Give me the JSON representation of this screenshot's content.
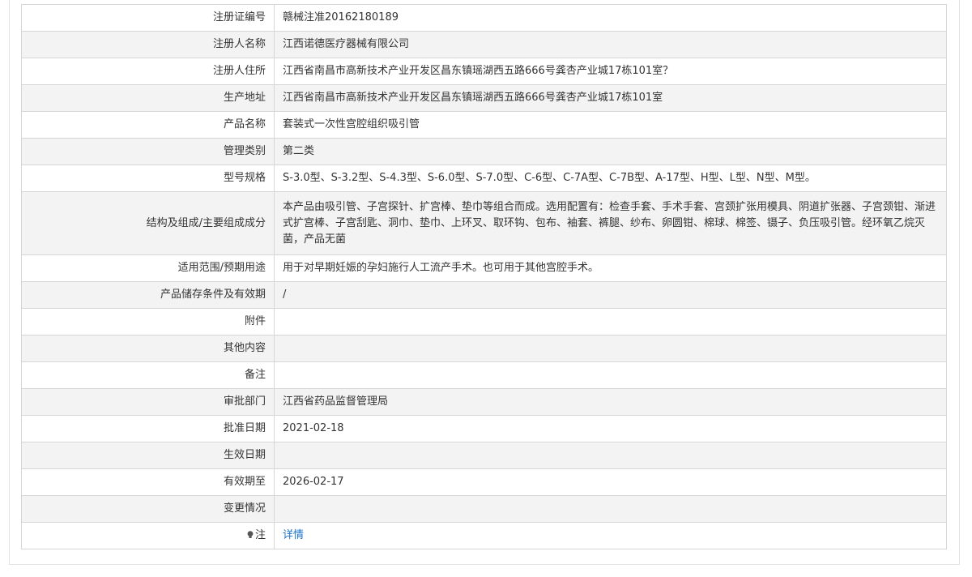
{
  "rows": [
    {
      "label": "注册证编号",
      "value": "赣械注准20162180189"
    },
    {
      "label": "注册人名称",
      "value": "江西诺德医疗器械有限公司"
    },
    {
      "label": "注册人住所",
      "value": "江西省南昌市高新技术产业开发区昌东镇瑶湖西五路666号龚杏产业城17栋101室？"
    },
    {
      "label": "生产地址",
      "value": "江西省南昌市高新技术产业开发区昌东镇瑶湖西五路666号龚杏产业城17栋101室"
    },
    {
      "label": "产品名称",
      "value": "套装式一次性宫腔组织吸引管"
    },
    {
      "label": "管理类别",
      "value": "第二类"
    },
    {
      "label": "型号规格",
      "value": "S-3.0型、S-3.2型、S-4.3型、S-6.0型、S-7.0型、C-6型、C-7A型、C-7B型、A-17型、H型、L型、N型、M型。"
    },
    {
      "label": "结构及组成/主要组成成分",
      "value": "本产品由吸引管、子宫探针、扩宫棒、垫巾等组合而成。选用配置有：检查手套、手术手套、宫颈扩张用模具、阴道扩张器、子宫颈钳、渐进式扩宫棒、子宫刮匙、洞巾、垫巾、上环叉、取环钩、包布、袖套、裤腿、纱布、卵圆钳、棉球、棉签、镊子、负压吸引管。经环氧乙烷灭菌，产品无菌"
    },
    {
      "label": "适用范围/预期用途",
      "value": "用于对早期妊娠的孕妇施行人工流产手术。也可用于其他宫腔手术。"
    },
    {
      "label": "产品储存条件及有效期",
      "value": "/"
    },
    {
      "label": "附件",
      "value": ""
    },
    {
      "label": "其他内容",
      "value": ""
    },
    {
      "label": "备注",
      "value": ""
    },
    {
      "label": "审批部门",
      "value": "江西省药品监督管理局"
    },
    {
      "label": "批准日期",
      "value": "2021-02-18"
    },
    {
      "label": "生效日期",
      "value": ""
    },
    {
      "label": "有效期至",
      "value": "2026-02-17"
    },
    {
      "label": "变更情况",
      "value": ""
    }
  ],
  "note": {
    "icon": "lightbulb-icon",
    "label": "注",
    "link_text": "详情"
  },
  "colors": {
    "link": "#1a73c9",
    "row_alt": "#f3f3f3",
    "border": "#d6d6d6",
    "text": "#333333"
  }
}
